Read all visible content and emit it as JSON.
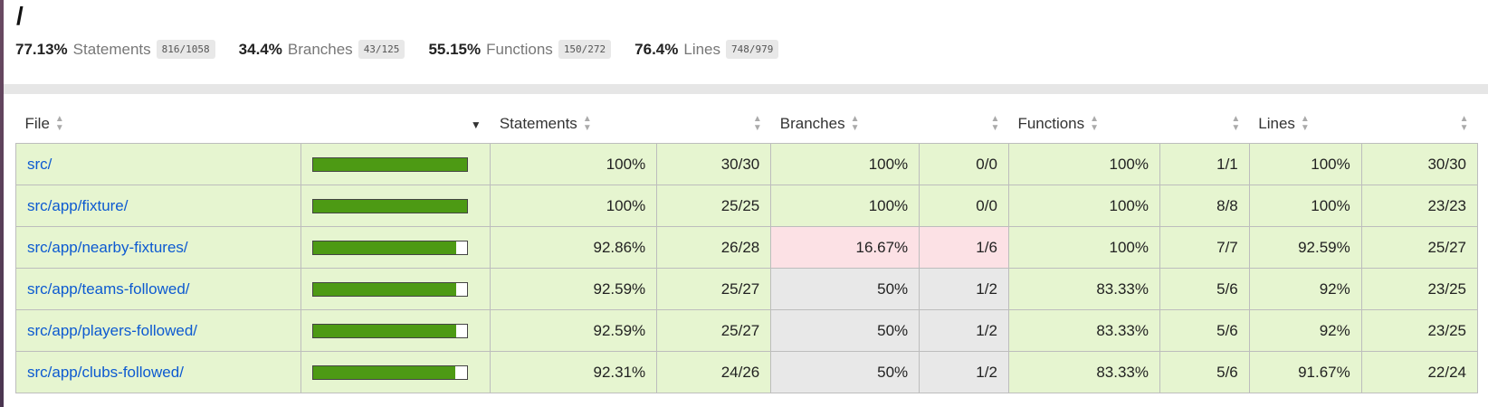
{
  "title": "/",
  "summary": [
    {
      "pct": "77.13%",
      "label": "Statements",
      "fraction": "816/1058"
    },
    {
      "pct": "34.4%",
      "label": "Branches",
      "fraction": "43/125"
    },
    {
      "pct": "55.15%",
      "label": "Functions",
      "fraction": "150/272"
    },
    {
      "pct": "76.4%",
      "label": "Lines",
      "fraction": "748/979"
    }
  ],
  "headers": {
    "file": "File",
    "statements": "Statements",
    "branches": "Branches",
    "functions": "Functions",
    "lines": "Lines"
  },
  "colors": {
    "high": "#e6f5d0",
    "low": "#fce1e5",
    "medium": "#e8e8e8",
    "bar_fill": "#4d9a14",
    "link": "#0d5ad1"
  },
  "rows": [
    {
      "file": "src/",
      "bar_pct": 100,
      "statements_pct": "100%",
      "statements": "30/30",
      "branches_pct": "100%",
      "branches": "0/0",
      "branches_level": "high",
      "functions_pct": "100%",
      "functions": "1/1",
      "lines_pct": "100%",
      "lines": "30/30"
    },
    {
      "file": "src/app/fixture/",
      "bar_pct": 100,
      "statements_pct": "100%",
      "statements": "25/25",
      "branches_pct": "100%",
      "branches": "0/0",
      "branches_level": "high",
      "functions_pct": "100%",
      "functions": "8/8",
      "lines_pct": "100%",
      "lines": "23/23"
    },
    {
      "file": "src/app/nearby-fixtures/",
      "bar_pct": 92.86,
      "statements_pct": "92.86%",
      "statements": "26/28",
      "branches_pct": "16.67%",
      "branches": "1/6",
      "branches_level": "low",
      "functions_pct": "100%",
      "functions": "7/7",
      "lines_pct": "92.59%",
      "lines": "25/27"
    },
    {
      "file": "src/app/teams-followed/",
      "bar_pct": 92.59,
      "statements_pct": "92.59%",
      "statements": "25/27",
      "branches_pct": "50%",
      "branches": "1/2",
      "branches_level": "medium",
      "functions_pct": "83.33%",
      "functions": "5/6",
      "lines_pct": "92%",
      "lines": "23/25"
    },
    {
      "file": "src/app/players-followed/",
      "bar_pct": 92.59,
      "statements_pct": "92.59%",
      "statements": "25/27",
      "branches_pct": "50%",
      "branches": "1/2",
      "branches_level": "medium",
      "functions_pct": "83.33%",
      "functions": "5/6",
      "lines_pct": "92%",
      "lines": "23/25"
    },
    {
      "file": "src/app/clubs-followed/",
      "bar_pct": 92.31,
      "statements_pct": "92.31%",
      "statements": "24/26",
      "branches_pct": "50%",
      "branches": "1/2",
      "branches_level": "medium",
      "functions_pct": "83.33%",
      "functions": "5/6",
      "lines_pct": "91.67%",
      "lines": "22/24"
    }
  ]
}
